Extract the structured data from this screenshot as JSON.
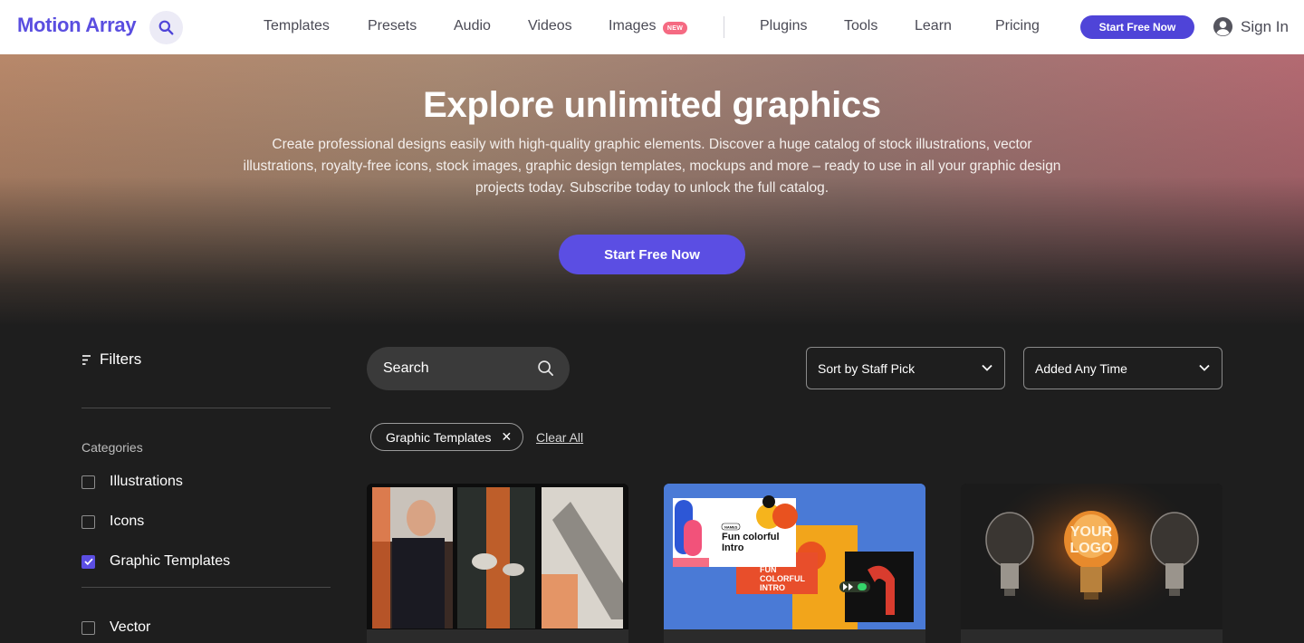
{
  "header": {
    "logo": "Motion Array",
    "nav": [
      {
        "label": "Templates"
      },
      {
        "label": "Presets"
      },
      {
        "label": "Audio"
      },
      {
        "label": "Videos"
      },
      {
        "label": "Images"
      },
      {
        "label": "Plugins"
      },
      {
        "label": "Tools"
      },
      {
        "label": "Learn"
      },
      {
        "label": "Pricing"
      }
    ],
    "images_badge": "NEW",
    "cta": "Start Free Now",
    "signin": "Sign In"
  },
  "hero": {
    "title": "Explore unlimited graphics",
    "description": "Create professional designs easily with high-quality graphic elements. Discover a huge catalog of stock illustrations, vector illustrations, royalty-free icons, stock images, graphic design templates, mockups and more – ready to use in all your graphic design projects today. Subscribe today to unlock the full catalog.",
    "cta": "Start Free Now"
  },
  "sidebar": {
    "filters_label": "Filters",
    "categories_title": "Categories",
    "categories": [
      {
        "label": "Illustrations",
        "checked": false
      },
      {
        "label": "Icons",
        "checked": false
      },
      {
        "label": "Graphic Templates",
        "checked": true
      },
      {
        "label": "Vector",
        "checked": false
      }
    ]
  },
  "toolbar": {
    "search_placeholder": "Search",
    "sort": "Sort by Staff Pick",
    "time": "Added Any Time"
  },
  "active_filters": {
    "chip": "Graphic Templates",
    "clear": "Clear All"
  },
  "cards": [
    {
      "name": "photo-collage-template"
    },
    {
      "name": "fun-colorful-intro-template",
      "text1": "Fun colorful",
      "text2": "Intro",
      "text3": "FUN",
      "text4": "COLORFUL",
      "text5": "INTRO",
      "tag": "NAMES"
    },
    {
      "name": "light-bulb-logo-template",
      "text1": "YOUR",
      "text2": "LOGO"
    }
  ],
  "colors": {
    "brand": "#5a4ee0",
    "accent": "#4f44d8",
    "badge": "#f56a82"
  }
}
